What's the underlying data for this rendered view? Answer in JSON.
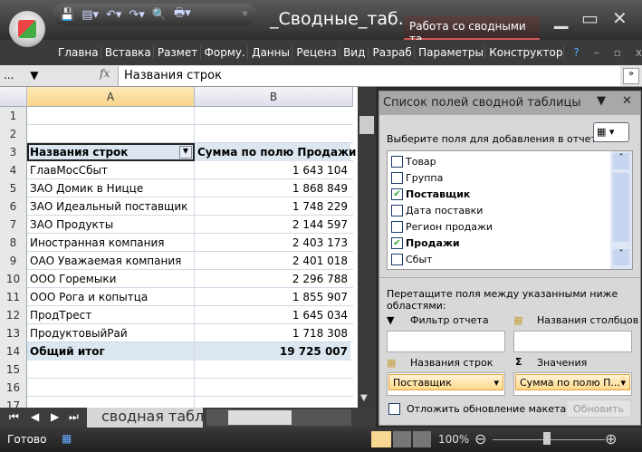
{
  "window": {
    "title": "_Сводные_таб...",
    "context_tab": "Работа со сводными та..."
  },
  "ribbon": {
    "tabs": [
      "Главна",
      "Вставка",
      "Размет",
      "Форму.",
      "Данны",
      "Реценз",
      "Вид",
      "Разраб",
      "Параметры",
      "Конструктор"
    ]
  },
  "formula_bar": {
    "name_box": "...",
    "fx": "fx",
    "value": "Названия строк"
  },
  "sheet": {
    "columns": [
      "A",
      "B"
    ],
    "header": {
      "row": "3",
      "a": "Названия строк",
      "b": "Сумма по полю Продажи"
    },
    "rows": [
      {
        "n": "4",
        "a": "ГлавМосСбыт",
        "b": "1 643 104"
      },
      {
        "n": "5",
        "a": "ЗАО Домик в Ницце",
        "b": "1 868 849"
      },
      {
        "n": "6",
        "a": "ЗАО Идеальный поставщик",
        "b": "1 748 229"
      },
      {
        "n": "7",
        "a": "ЗАО Продукты",
        "b": "2 144 597"
      },
      {
        "n": "8",
        "a": "Иностранная компания",
        "b": "2 403 173"
      },
      {
        "n": "9",
        "a": "ОАО Уважаемая компания",
        "b": "2 401 018"
      },
      {
        "n": "10",
        "a": "ООО Горемыки",
        "b": "2 296 788"
      },
      {
        "n": "11",
        "a": "ООО Рога и копытца",
        "b": "1 855 907"
      },
      {
        "n": "12",
        "a": "ПродТрест",
        "b": "1 645 034"
      },
      {
        "n": "13",
        "a": "ПродуктовыйРай",
        "b": "1 718 308"
      }
    ],
    "total": {
      "n": "14",
      "a": "Общий итог",
      "b": "19 725 007"
    },
    "empty_rows": [
      "1",
      "2",
      "15",
      "16",
      "17"
    ],
    "sheet_tab": "сводная табли"
  },
  "pane": {
    "title": "Список полей сводной таблицы",
    "choose_label": "Выберите поля для добавления в отчет:",
    "fields": [
      {
        "name": "Товар",
        "checked": false
      },
      {
        "name": "Группа",
        "checked": false
      },
      {
        "name": "Поставщик",
        "checked": true
      },
      {
        "name": "Дата поставки",
        "checked": false
      },
      {
        "name": "Регион продажи",
        "checked": false
      },
      {
        "name": "Продажи",
        "checked": true
      },
      {
        "name": "Сбыт",
        "checked": false
      }
    ],
    "drag_label": "Перетащите поля между указанными ниже областями:",
    "filter_label": "Фильтр отчета",
    "columns_label": "Названия столбцов",
    "rows_label": "Названия строк",
    "values_label": "Значения",
    "rows_item": "Поставщик",
    "values_item": "Сумма по полю П...",
    "defer_label": "Отложить обновление макета",
    "update_button": "Обновить"
  },
  "status": {
    "ready": "Готово",
    "zoom": "100%",
    "zoom_level": 100
  }
}
